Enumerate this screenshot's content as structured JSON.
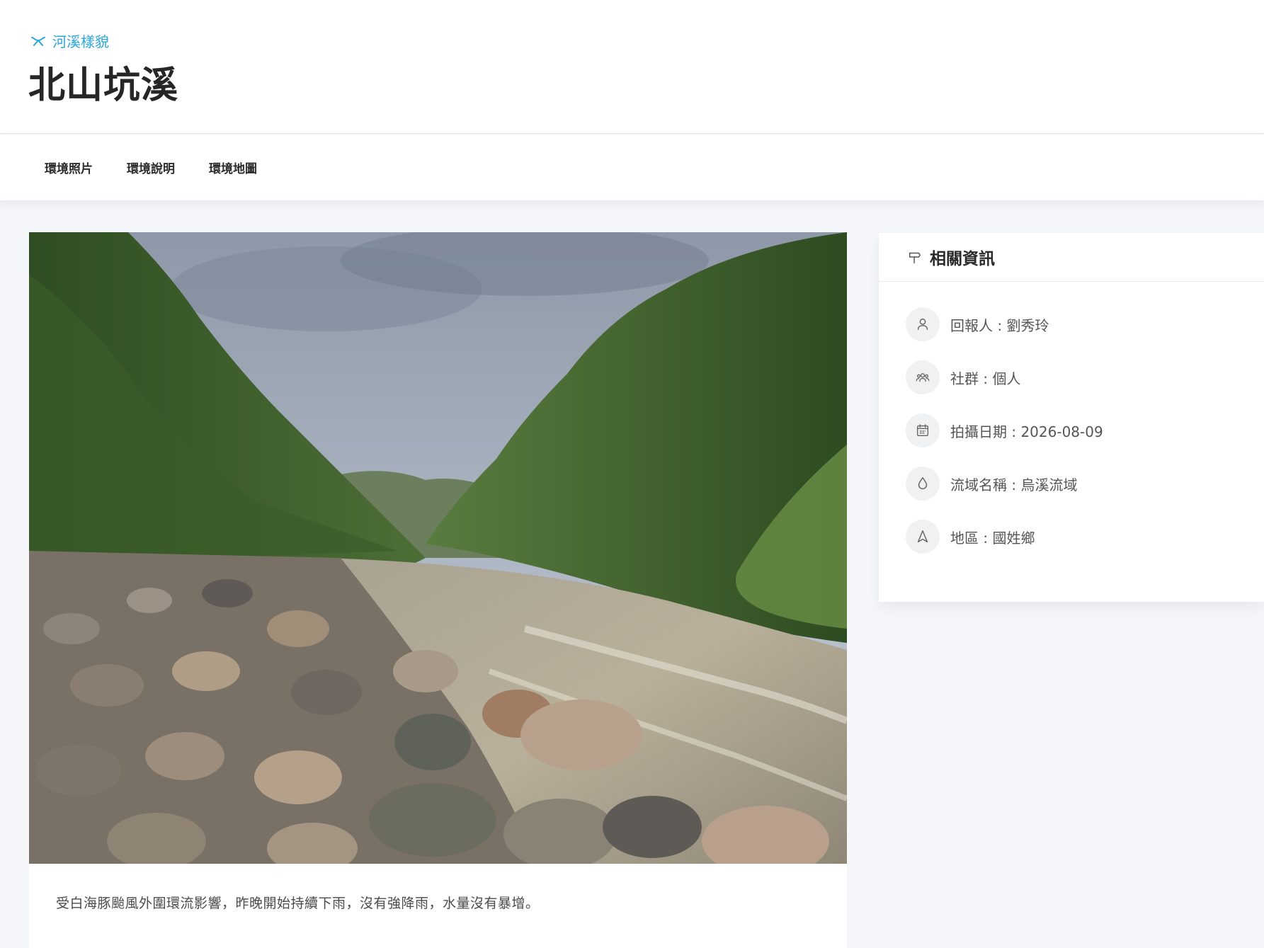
{
  "header": {
    "breadcrumb": "河溪樣貌",
    "title": "北山坑溪"
  },
  "tabs": [
    {
      "label": "環境照片"
    },
    {
      "label": "環境說明"
    },
    {
      "label": "環境地圖"
    }
  ],
  "photo": {
    "caption": "受白海豚颱風外圍環流影響，昨晚開始持續下雨，沒有強降雨，水量沒有暴增。"
  },
  "info": {
    "title": "相關資訊",
    "items": [
      {
        "icon": "user-icon",
        "text": "回報人 : 劉秀玲"
      },
      {
        "icon": "group-icon",
        "text": "社群 : 個人"
      },
      {
        "icon": "calendar-icon",
        "text": "拍攝日期 : 2026-08-09"
      },
      {
        "icon": "water-drop-icon",
        "text": "流域名稱 : 烏溪流域"
      },
      {
        "icon": "navigation-icon",
        "text": "地區 : 國姓鄉"
      }
    ]
  },
  "colors": {
    "accent": "#2ba6d9",
    "background": "#f5f6f9"
  }
}
